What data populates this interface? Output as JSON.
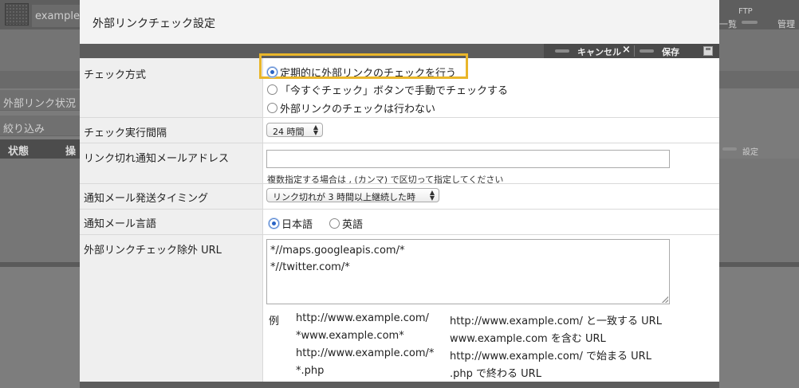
{
  "background": {
    "site_tab": "examples",
    "nav_list": "一覧",
    "nav_ftp": "FTP",
    "nav_admin": "管理",
    "settings": "設定",
    "sidebar_rows": [
      "外部リンク状況",
      "絞り込み"
    ],
    "table_headers": [
      "状態",
      "操作"
    ]
  },
  "dialog": {
    "title": "外部リンクチェック設定",
    "toolbar": {
      "cancel_label": "キャンセル",
      "cancel_x": "×",
      "save_label": "保存"
    },
    "check_method": {
      "label": "チェック方式",
      "options": [
        {
          "label": "定期的に外部リンクのチェックを行う",
          "selected": true
        },
        {
          "label": "「今すぐチェック」ボタンで手動でチェックする",
          "selected": false
        },
        {
          "label": "外部リンクのチェックは行わない",
          "selected": false
        }
      ]
    },
    "interval": {
      "label": "チェック実行間隔",
      "value": "24 時間"
    },
    "notify_email": {
      "label": "リンク切れ通知メールアドレス",
      "value": "",
      "hint": "複数指定する場合は , (カンマ) で区切って指定してください"
    },
    "notify_timing": {
      "label": "通知メール発送タイミング",
      "value": "リンク切れが 3 時間以上継続した時"
    },
    "notify_language": {
      "label": "通知メール言語",
      "options": [
        {
          "label": "日本語",
          "selected": true
        },
        {
          "label": "英語",
          "selected": false
        }
      ]
    },
    "exclude_urls": {
      "label": "外部リンクチェック除外 URL",
      "lines": [
        "*//maps.googleapis.com/*",
        "*//twitter.com/*"
      ],
      "example_label": "例",
      "examples": [
        {
          "pattern": "http://www.example.com/",
          "desc": "http://www.example.com/ と一致する URL"
        },
        {
          "pattern": "*www.example.com*",
          "desc": "www.example.com を含む URL"
        },
        {
          "pattern": "http://www.example.com/*",
          "desc": "http://www.example.com/ で始まる URL"
        },
        {
          "pattern": "*.php",
          "desc": ".php で終わる URL"
        }
      ]
    }
  },
  "colors": {
    "highlight": "#e9b62a",
    "radio_selected": "#2a64c5",
    "toolbar": "#5c5c5c"
  }
}
